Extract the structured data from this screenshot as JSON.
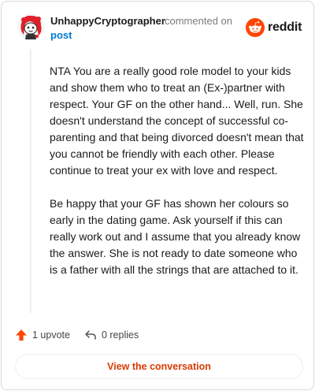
{
  "comment": {
    "username": "UnhappyCryptographer",
    "action_text": "commented on",
    "target_link": "post",
    "paragraphs": [
      "NTA You are a really good role model to your kids and show them who to treat an (Ex-)partner with respect. Your GF on the other hand... Well, run. She doesn't understand the concept of successful co-parenting and that being divorced doesn't mean that you cannot be friendly with each other. Please continue to treat your ex with love and respect.",
      "Be happy that your GF has shown her colours so early in the dating game. Ask yourself if this can really work out and I assume that you already know the answer. She is not ready to date someone who is a father with all the strings that are attached to it."
    ]
  },
  "brand": {
    "logo_text": "reddit",
    "icon": "reddit-alien-icon",
    "color": "#ff4500"
  },
  "actions": {
    "upvote_count": "1 upvote",
    "reply_count": "0 replies"
  },
  "view_button_label": "View the conversation",
  "colors": {
    "accent": "#ff4500",
    "link": "#0079d3",
    "button_text": "#d93a00"
  }
}
